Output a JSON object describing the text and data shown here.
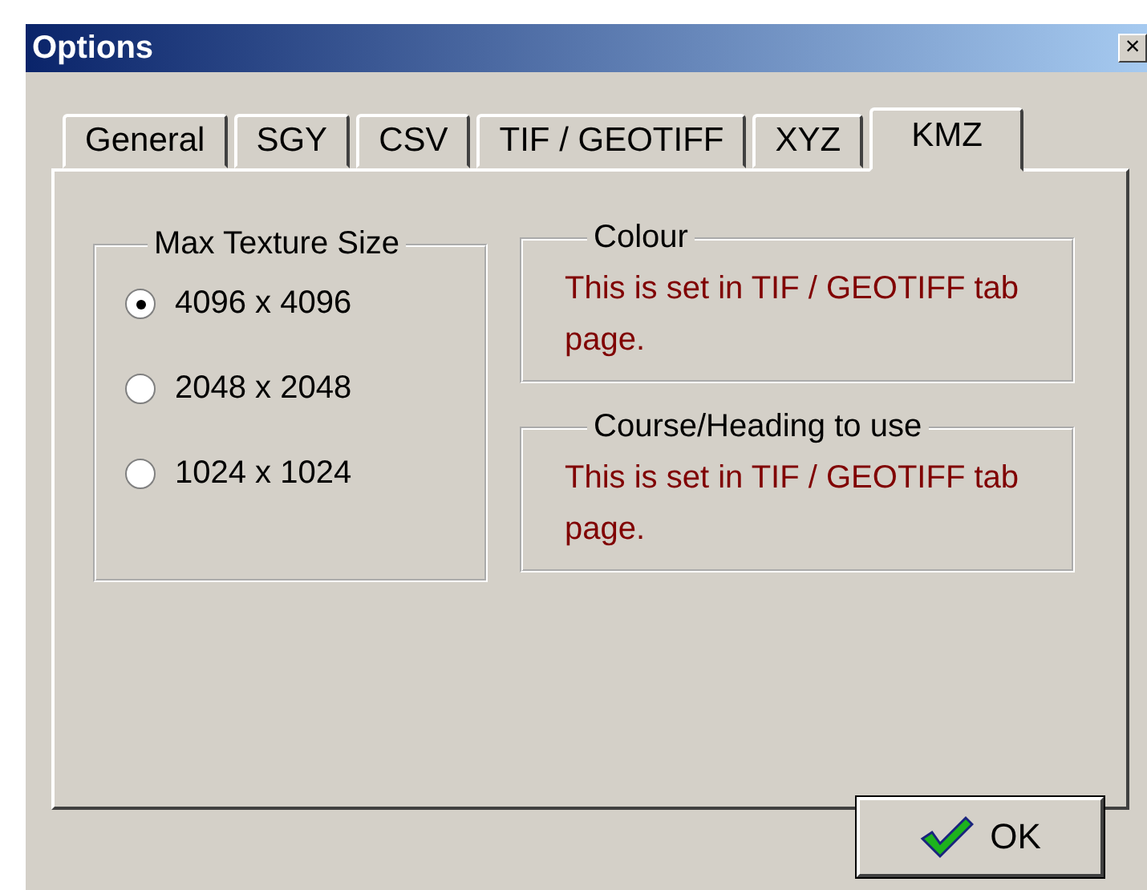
{
  "window": {
    "title": "Options",
    "close": "×"
  },
  "tabs": [
    {
      "label": "General",
      "selected": false
    },
    {
      "label": "SGY",
      "selected": false
    },
    {
      "label": "CSV",
      "selected": false
    },
    {
      "label": "TIF / GEOTIFF",
      "selected": false
    },
    {
      "label": "XYZ",
      "selected": false
    },
    {
      "label": "KMZ",
      "selected": true
    }
  ],
  "texture_group": {
    "title": "Max Texture Size",
    "options": [
      {
        "label": "4096 x 4096",
        "selected": true
      },
      {
        "label": "2048 x 2048",
        "selected": false
      },
      {
        "label": "1024 x 1024",
        "selected": false
      }
    ]
  },
  "info_groups": [
    {
      "title": "Colour",
      "message": "This is set in TIF / GEOTIFF tab page."
    },
    {
      "title": "Course/Heading to use",
      "message": "This is set in TIF / GEOTIFF tab page."
    }
  ],
  "buttons": [
    {
      "label": "OK",
      "kind": "ok"
    }
  ]
}
